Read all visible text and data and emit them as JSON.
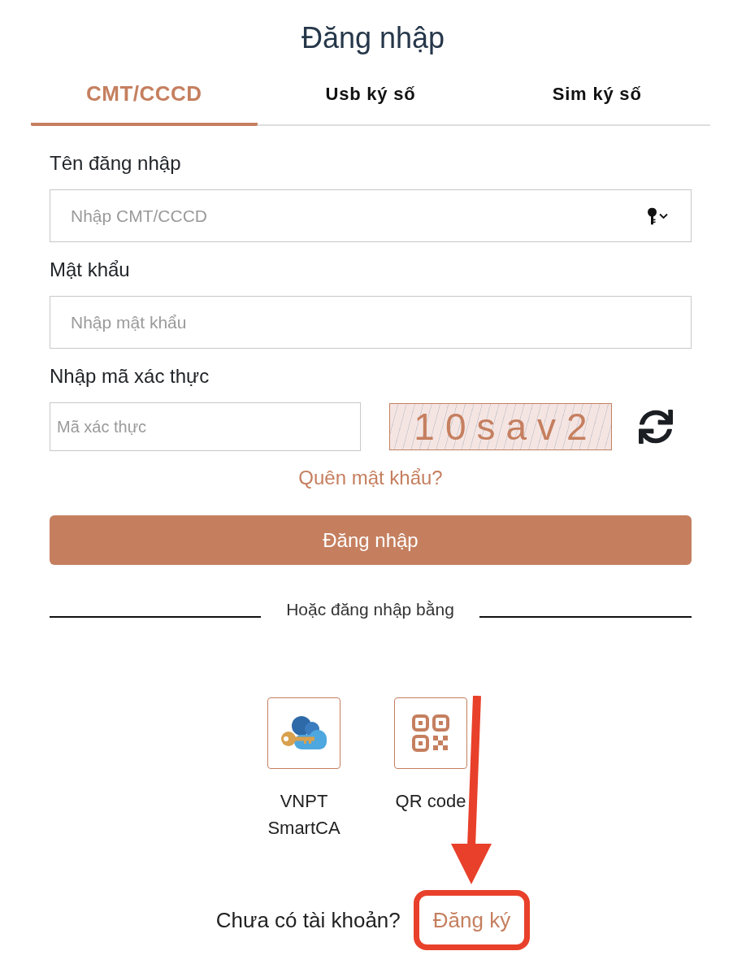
{
  "title": "Đăng nhập",
  "tabs": [
    {
      "label": "CMT/CCCD",
      "selected": true
    },
    {
      "label": "Usb ký số",
      "selected": false
    },
    {
      "label": "Sim ký số",
      "selected": false
    }
  ],
  "form": {
    "fields": [
      {
        "label": "Tên đăng nhập",
        "placeholder": "Nhập CMT/CCCD",
        "kind": "key_dropdown"
      },
      {
        "label": "Mật khẩu",
        "placeholder": "Nhập mật khẩu",
        "kind": "password"
      }
    ],
    "captcha": {
      "label": "Nhập mã xác thực",
      "placeholder": "Mã xác thực",
      "code": "10sav2"
    },
    "forgot_link": "Quên mật khẩu?",
    "submit_button": "Đăng nhập"
  },
  "alt_login": {
    "divider_text": "Hoặc đăng nhập bằng",
    "options": [
      {
        "label": "VNPT SmartCA",
        "kind": "smartca"
      },
      {
        "label": "QR code",
        "kind": "qr"
      }
    ]
  },
  "signup": {
    "prompt": "Chưa có tài khoản?",
    "link": "Đăng ký",
    "highlighted": true
  }
}
